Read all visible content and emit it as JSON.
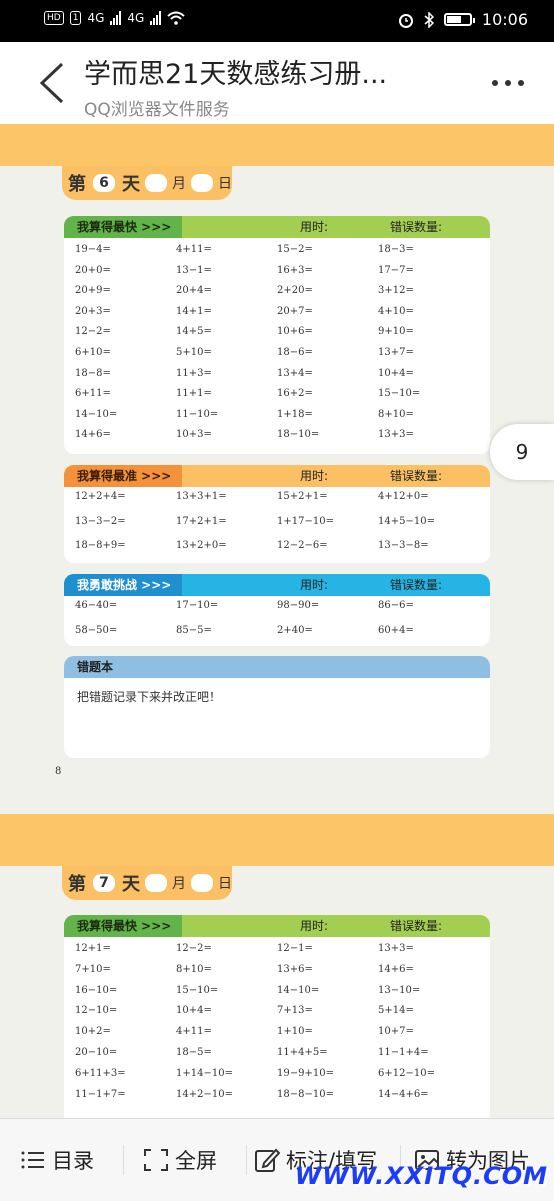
{
  "status_bar": {
    "network": "4G",
    "hd_label": "HD",
    "sim": "1",
    "time": "10:06"
  },
  "header": {
    "title": "学而思21天数感练习册...",
    "subtitle": "QQ浏览器文件服务"
  },
  "colors": {
    "green": "#a2ce51",
    "green_dark": "#62b44a",
    "orange": "#fbc063",
    "orange_dark": "#f3923a",
    "blue": "#25b4e4",
    "blue_dark": "#1f8fd0",
    "lightblue": "#8ebfe3"
  },
  "page_indicator": "9",
  "pages": [
    {
      "day_label": "第",
      "day": "6",
      "day_suffix": "天",
      "month": "月",
      "date": "日",
      "page_number": "8",
      "sections": [
        {
          "label": "我算得最快 >>>",
          "time_label": "用时:",
          "error_label": "错误数量:",
          "rows": [
            [
              "19−4=",
              "4+11=",
              "15−2=",
              "18−3="
            ],
            [
              "20+0=",
              "13−1=",
              "16+3=",
              "17−7="
            ],
            [
              "20+9=",
              "20+4=",
              "2+20=",
              "3+12="
            ],
            [
              "20+3=",
              "14+1=",
              "20+7=",
              "4+10="
            ],
            [
              "12−2=",
              "14+5=",
              "10+6=",
              "9+10="
            ],
            [
              "6+10=",
              "5+10=",
              "18−6=",
              "13+7="
            ],
            [
              "18−8=",
              "11+3=",
              "13+4=",
              "10+4="
            ],
            [
              "6+11=",
              "11+1=",
              "16+2=",
              "15−10="
            ],
            [
              "14−10=",
              "11−10=",
              "1+18=",
              "8+10="
            ],
            [
              "14+6=",
              "10+3=",
              "18−10=",
              "13+3="
            ]
          ]
        },
        {
          "label": "我算得最准 >>>",
          "time_label": "用时:",
          "error_label": "错误数量:",
          "rows": [
            [
              "12+2+4=",
              "13+3+1=",
              "15+2+1=",
              "4+12+0="
            ],
            [
              "13−3−2=",
              "17+2+1=",
              "1+17−10=",
              "14+5−10="
            ],
            [
              "18−8+9=",
              "13+2+0=",
              "12−2−6=",
              "13−3−8="
            ]
          ]
        },
        {
          "label": "我勇敢挑战 >>>",
          "time_label": "用时:",
          "error_label": "错误数量:",
          "rows": [
            [
              "46−40=",
              "17−10=",
              "98−90=",
              "86−6="
            ],
            [
              "58−50=",
              "85−5=",
              "2+40=",
              "60+4="
            ]
          ]
        }
      ],
      "mistakes": {
        "label": "错题本",
        "text": "把错题记录下来并改正吧！"
      }
    },
    {
      "day_label": "第",
      "day": "7",
      "day_suffix": "天",
      "month": "月",
      "date": "日",
      "sections": [
        {
          "label": "我算得最快 >>>",
          "time_label": "用时:",
          "error_label": "错误数量:",
          "rows": [
            [
              "12+1=",
              "12−2=",
              "12−1=",
              "13+3="
            ],
            [
              "7+10=",
              "8+10=",
              "13+6=",
              "14+6="
            ],
            [
              "16−10=",
              "15−10=",
              "14−10=",
              "13−10="
            ],
            [
              "12−10=",
              "10+4=",
              "7+13=",
              "5+14="
            ],
            [
              "10+2=",
              "4+11=",
              "1+10=",
              "10+7="
            ],
            [
              "20−10=",
              "18−5=",
              "11+4+5=",
              "11−1+4="
            ],
            [
              "6+11+3=",
              "1+14−10=",
              "19−9+10=",
              "6+12−10="
            ],
            [
              "11−1+7=",
              "14+2−10=",
              "18−8−10=",
              "14−4+6="
            ]
          ]
        }
      ]
    }
  ],
  "bottom_bar": [
    {
      "label": "目录",
      "icon": "list-icon"
    },
    {
      "label": "全屏",
      "icon": "fullscreen-icon"
    },
    {
      "label": "标注/填写",
      "icon": "edit-icon"
    },
    {
      "label": "转为图片",
      "icon": "image-icon"
    }
  ],
  "watermark": "WWW.XXITQ.COM"
}
